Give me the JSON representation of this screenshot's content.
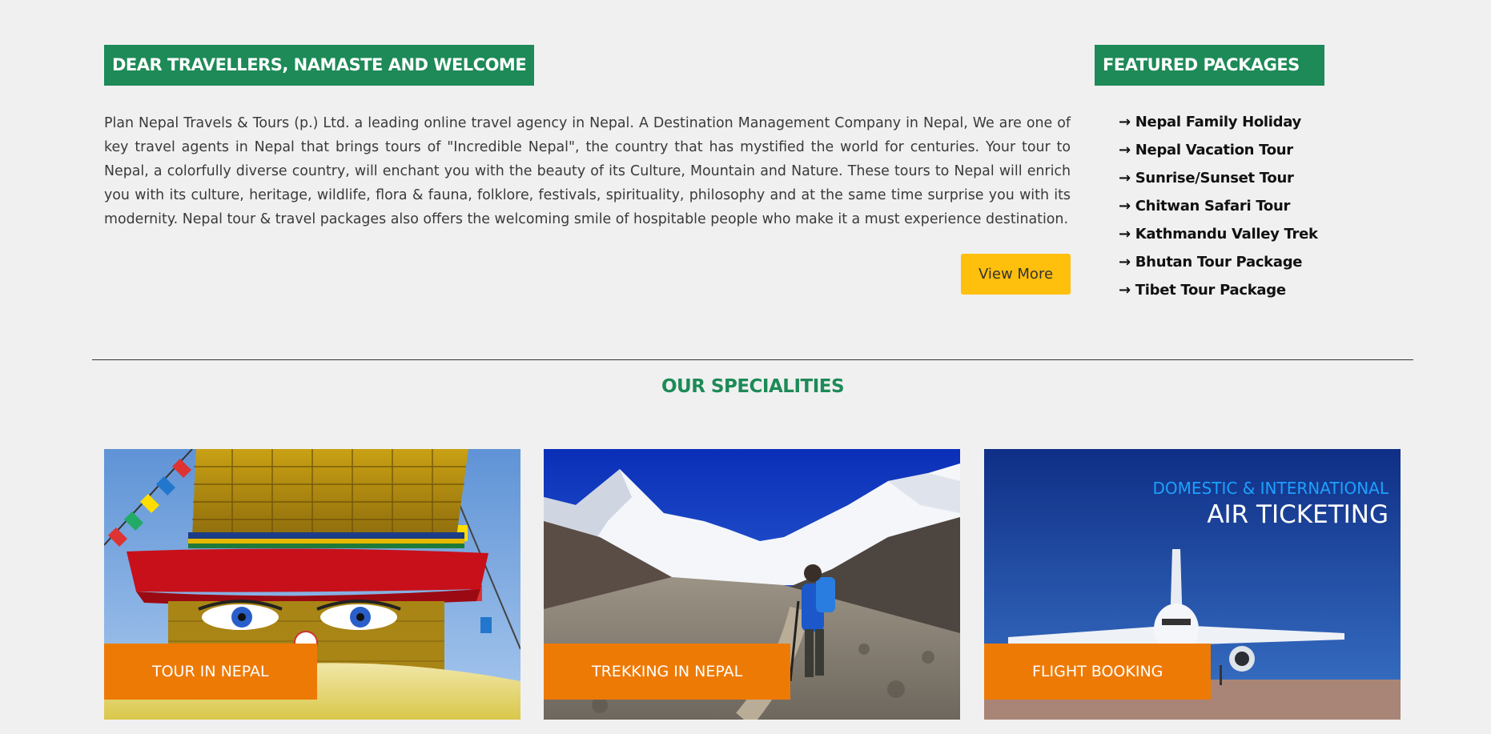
{
  "welcome": {
    "heading": "DEAR TRAVELLERS, NAMASTE AND WELCOME",
    "text": "Plan Nepal Travels & Tours (p.) Ltd. a leading online travel agency in Nepal. A Destination Management Company in Nepal, We are one of key travel agents in Nepal that brings tours of \"Incredible Nepal\", the country that has mystified the world for centuries. Your tour to Nepal, a colorfully diverse country, will enchant you with the beauty of its Culture, Mountain and Nature. These tours to Nepal will enrich you with its culture, heritage, wildlife, flora & fauna, folklore, festivals, spirituality, philosophy and at the same time surprise you with its modernity. Nepal tour & travel packages also offers the welcoming smile of hospitable people who make it a must experience destination.",
    "view_more_label": "View More"
  },
  "featured": {
    "heading": "FEATURED PACKAGES",
    "bullet": "→",
    "items": [
      "Nepal Family Holiday",
      "Nepal Vacation Tour",
      "Sunrise/Sunset Tour",
      "Chitwan Safari Tour",
      "Kathmandu Valley Trek",
      "Bhutan Tour Package",
      "Tibet Tour Package"
    ]
  },
  "specialities": {
    "title": "OUR SPECIALITIES",
    "cards": [
      {
        "label": "TOUR IN NEPAL",
        "image": "boudhanath-stupa-eyes"
      },
      {
        "label": "TREKKING IN NEPAL",
        "image": "trekker-himalaya-valley"
      },
      {
        "label": "FLIGHT BOOKING",
        "image": "airplane-air-ticketing",
        "image_text_line1": "DOMESTIC & INTERNATIONAL",
        "image_text_line2": "AIR TICKETING"
      }
    ]
  },
  "colors": {
    "brand_green": "#1d8a57",
    "button_yellow": "#ffbf0d",
    "label_orange": "#ee7a06",
    "background": "#f0f0f0"
  }
}
